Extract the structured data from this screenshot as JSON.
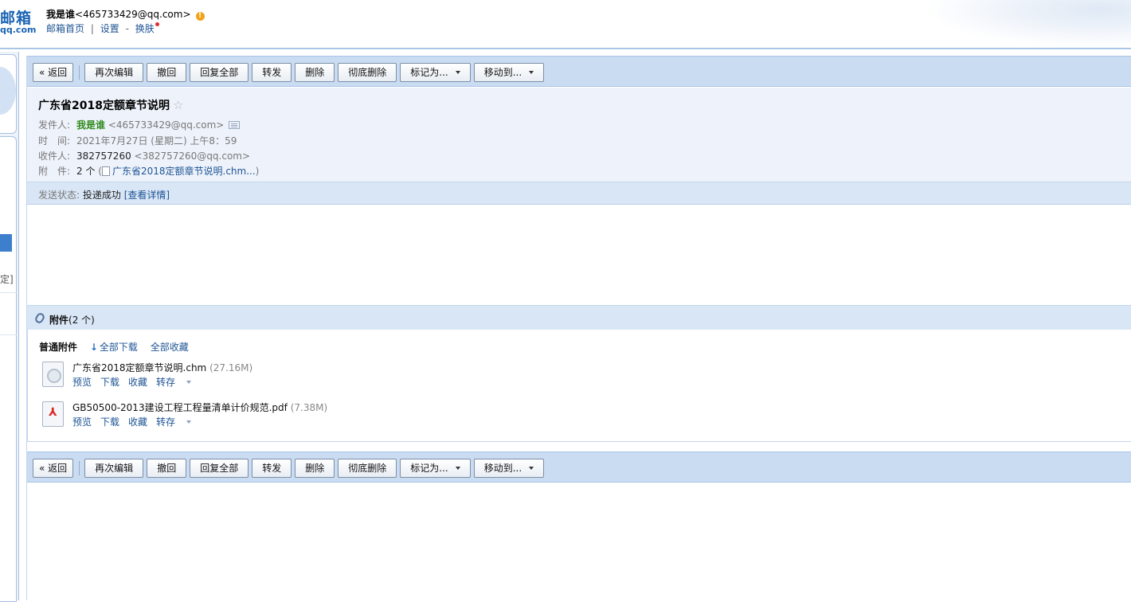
{
  "header": {
    "logo_main": "邮箱",
    "logo_sub": "qq.com",
    "user_name": "我是谁",
    "user_email": "<465733429@qq.com>",
    "link_home": "邮箱首页",
    "link_settings": "设置",
    "link_skin": "换肤",
    "separator": "|",
    "dash": "-"
  },
  "sidebar": {
    "partial_text": "定]"
  },
  "toolbar": {
    "back": "« 返回",
    "reedit": "再次编辑",
    "recall": "撤回",
    "reply_all": "回复全部",
    "forward": "转发",
    "delete": "删除",
    "delete_forever": "彻底删除",
    "mark_as": "标记为...",
    "move_to": "移动到..."
  },
  "mail": {
    "subject": "广东省2018定额章节说明",
    "star": "☆",
    "from_label": "发件人:",
    "from_name": "我是谁",
    "from_email": "<465733429@qq.com>",
    "time_label": "时　间:",
    "time_value": "2021年7月27日 (星期二) 上午8：59",
    "to_label": "收件人:",
    "to_name": "382757260",
    "to_email": "<382757260@qq.com>",
    "att_label": "附　件:",
    "att_count": "2 个",
    "att_open": "(",
    "att_preview": "广东省2018定额章节说明.chm...",
    "att_close": ")",
    "status_label": "发送状态:",
    "status_value": "投递成功",
    "status_link": "[查看详情]"
  },
  "attachments": {
    "title": "附件",
    "count": "(2 个)",
    "section_label": "普通附件",
    "download_all": "全部下载",
    "collect_all": "全部收藏",
    "items": [
      {
        "name": "广东省2018定额章节说明.chm",
        "size": "(27.16M)",
        "type": "chm",
        "preview": "预览",
        "download": "下载",
        "collect": "收藏",
        "save_to": "转存"
      },
      {
        "name": "GB50500-2013建设工程工程量清单计价规范.pdf",
        "size": "(7.38M)",
        "type": "pdf",
        "preview": "预览",
        "download": "下载",
        "collect": "收藏",
        "save_to": "转存"
      }
    ]
  },
  "colors": {
    "toolbar_bg": "#c9dcf2",
    "header_bg": "#eef3fb",
    "link": "#1e5494",
    "sender_green": "#2f8a1c"
  }
}
